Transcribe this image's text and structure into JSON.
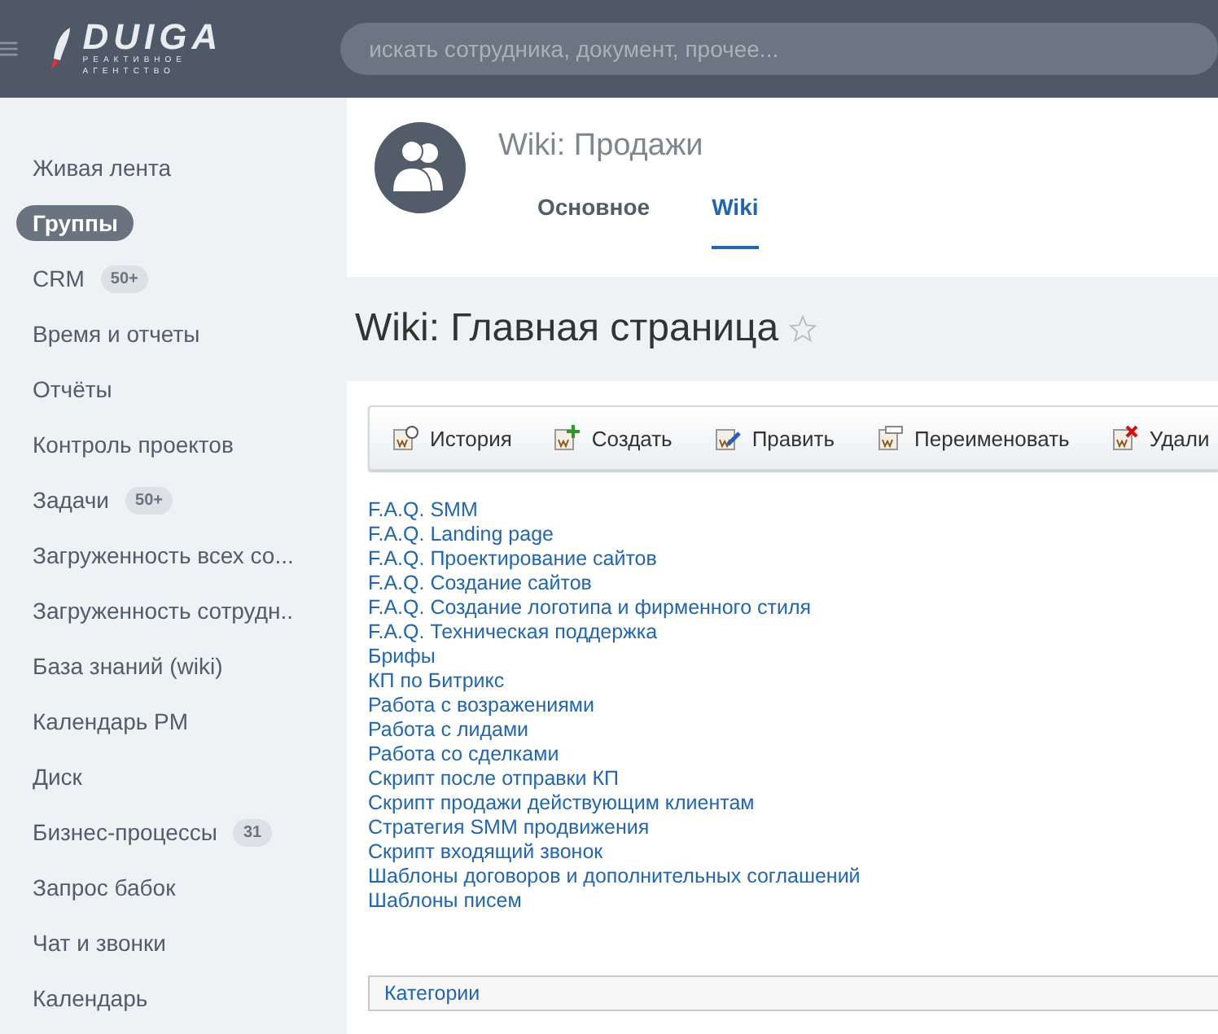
{
  "header": {
    "logo": {
      "name": "DUIGA",
      "tagline": [
        "РЕАКТИВНОЕ",
        "АГЕНТСТВО"
      ]
    },
    "search": {
      "placeholder": "искать сотрудника, документ, прочее..."
    }
  },
  "sidebar": {
    "items": [
      {
        "label": "Живая лента",
        "selected": false
      },
      {
        "label": "Группы",
        "selected": true
      },
      {
        "label": "CRM",
        "selected": false,
        "badge": "50+"
      },
      {
        "label": "Время и отчеты",
        "selected": false
      },
      {
        "label": "Отчёты",
        "selected": false
      },
      {
        "label": "Контроль проектов",
        "selected": false
      },
      {
        "label": "Задачи",
        "selected": false,
        "badge": "50+"
      },
      {
        "label": "Загруженность всех со...",
        "selected": false
      },
      {
        "label": "Загруженность сотрудн..",
        "selected": false
      },
      {
        "label": "База знаний (wiki)",
        "selected": false
      },
      {
        "label": "Календарь PM",
        "selected": false
      },
      {
        "label": "Диск",
        "selected": false
      },
      {
        "label": "Бизнес-процессы",
        "selected": false,
        "badge": "31"
      },
      {
        "label": "Запрос бабок",
        "selected": false
      },
      {
        "label": "Чат и звонки",
        "selected": false
      },
      {
        "label": "Календарь",
        "selected": false
      }
    ]
  },
  "group": {
    "title": "Wiki: Продажи",
    "tabs": [
      {
        "label": "Основное",
        "selected": false
      },
      {
        "label": "Wiki",
        "selected": true
      }
    ]
  },
  "page_title": "Wiki: Главная страница",
  "toolbar": [
    {
      "kind": "history",
      "label": "История"
    },
    {
      "kind": "create",
      "label": "Создать"
    },
    {
      "kind": "edit",
      "label": "Править"
    },
    {
      "kind": "rename",
      "label": "Переименовать"
    },
    {
      "kind": "delete",
      "label": "Удали"
    }
  ],
  "links": [
    "F.A.Q. SMM",
    "F.A.Q. Landing page",
    "F.A.Q. Проектирование сайтов",
    "F.A.Q. Создание сайтов",
    "F.A.Q. Создание логотипа и фирменного стиля",
    "F.A.Q. Техническая поддержка",
    "Брифы",
    "КП по Битрикс",
    "Работа с возражениями",
    "Работа с лидами",
    "Работа со сделками",
    "Скрипт после отправки КП",
    "Скрипт продажи действующим клиентам",
    "Стратегия SMM продвижения",
    "Скрипт входящий звонок",
    "Шаблоны договоров и дополнительных соглашений",
    "Шаблоны писем"
  ],
  "categories": "Категории"
}
